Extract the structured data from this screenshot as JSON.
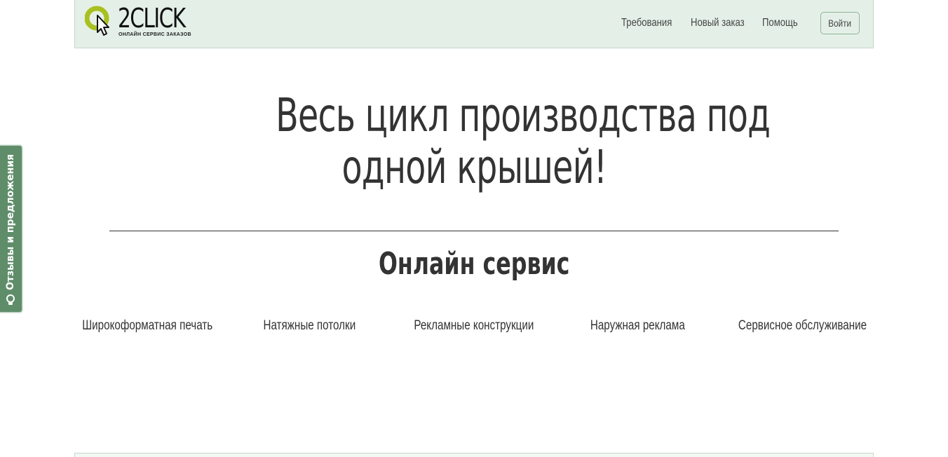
{
  "brand": {
    "logo_text": "2CLICK",
    "tagline": "ОНЛАЙН СЕРВИС ЗАКАЗОВ"
  },
  "nav": {
    "items": [
      {
        "label": "Требования"
      },
      {
        "label": "Новый заказ"
      },
      {
        "label": "Помощь"
      }
    ],
    "login_label": "Войти"
  },
  "hero": {
    "line1": "Весь цикл производства под",
    "line2": "одной крышей!"
  },
  "section": {
    "title": "Онлайн сервис"
  },
  "services": [
    {
      "label": "Широкоформатная печать"
    },
    {
      "label": "Натяжные потолки"
    },
    {
      "label": "Рекламные конструкции"
    },
    {
      "label": "Наружная реклама"
    },
    {
      "label": "Сервисное обслуживание"
    }
  ],
  "feedback": {
    "label": "Отзывы и предложения"
  },
  "colors": {
    "navbar_bg": "#e4f0e7",
    "brand_green": "#a8c020",
    "feedback_green": "#5f8d6a",
    "text": "#333333"
  }
}
